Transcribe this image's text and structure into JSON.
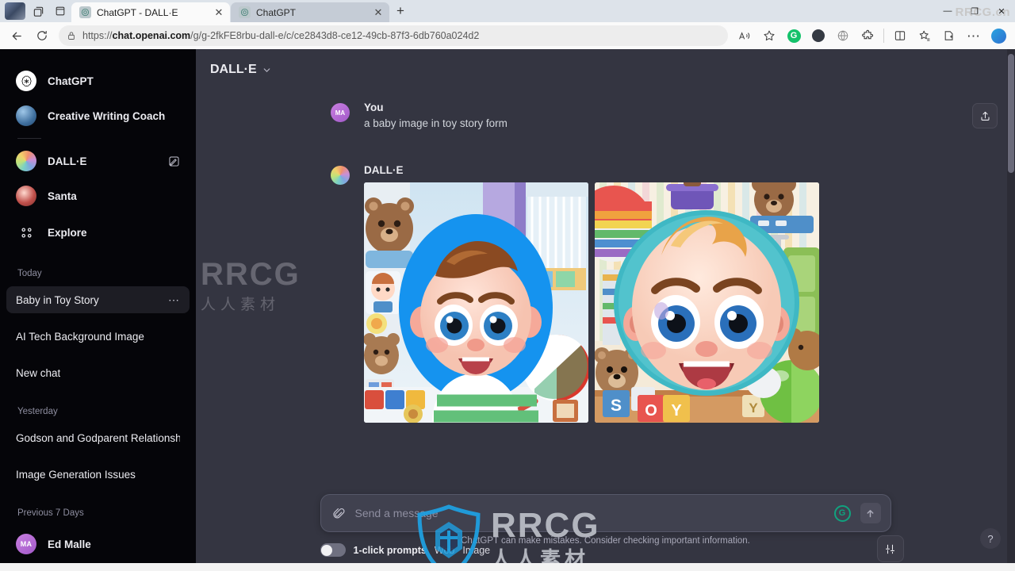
{
  "browser": {
    "tabs": [
      {
        "title": "ChatGPT - DALL·E",
        "active": true,
        "close": "✕"
      },
      {
        "title": "ChatGPT",
        "active": false,
        "close": "✕"
      }
    ],
    "new_tab_label": "+",
    "window_controls": {
      "minimize": "—",
      "maximize": "❐",
      "close": "✕"
    },
    "window_watermark": "RRCG.cn",
    "url_prefix": "https://",
    "url_domain": "chat.openai.com",
    "url_path": "/g/g-2fkFE8rbu-dall-e/c/ce2843d8-ce12-49cb-87f3-6db760a024d2",
    "nav": {
      "back": "back-arrow",
      "reload": "reload-arrow",
      "lock": "lock-icon"
    },
    "toolbar_icons": [
      "read-aloud-icon",
      "favorite-star-icon",
      "grammarly-extension-icon",
      "dark-extension-icon",
      "translate-globe-icon",
      "extensions-puzzle-icon",
      "split-screen-icon",
      "collections-icon",
      "browser-essentials-icon",
      "settings-ellipsis-icon",
      "copilot-icon"
    ]
  },
  "sidebar": {
    "gpts": [
      {
        "name": "ChatGPT",
        "icon": "openai-logo-icon",
        "active": false,
        "edit": false
      },
      {
        "name": "Creative Writing Coach",
        "icon": "coach-avatar-icon",
        "active": false,
        "edit": false
      },
      {
        "name": "DALL·E",
        "icon": "dalle-avatar-icon",
        "active": true,
        "edit": true
      },
      {
        "name": "Santa",
        "icon": "santa-avatar-icon",
        "active": false,
        "edit": false
      }
    ],
    "explore": {
      "label": "Explore",
      "icon": "grid-icon"
    },
    "sections": [
      {
        "label": "Today",
        "items": [
          {
            "title": "Baby in Toy Story",
            "active": true,
            "menu": "⋯"
          },
          {
            "title": "AI Tech Background Image",
            "active": false,
            "menu": ""
          },
          {
            "title": "New chat",
            "active": false,
            "menu": ""
          }
        ]
      },
      {
        "label": "Yesterday",
        "items": [
          {
            "title": "Godson and Godparent Relationship",
            "active": false,
            "menu": ""
          },
          {
            "title": "Image Generation Issues",
            "active": false,
            "menu": ""
          }
        ]
      },
      {
        "label": "Previous 7 Days",
        "items": []
      }
    ],
    "user": {
      "name": "Ed Malle",
      "initials": "MA"
    }
  },
  "main": {
    "model_name": "DALL·E",
    "model_chevron": "chevron-down-icon",
    "share_icon": "share-upload-icon",
    "messages": [
      {
        "author": "You",
        "initials": "MA",
        "text": "a baby image in toy story form",
        "type": "user"
      },
      {
        "author": "DALL·E",
        "initials": "",
        "text": "",
        "type": "assistant",
        "images": [
          {
            "alt": "Cartoon baby with blue oval background in a toy-filled nursery"
          },
          {
            "alt": "Close-up cartoon baby face with teal circle background and alphabet blocks"
          }
        ]
      }
    ],
    "composer": {
      "attach_icon": "paperclip-icon",
      "placeholder": "Send a message",
      "assist_icon": "grammarly-circle-icon",
      "send_icon": "send-arrow-up-icon"
    },
    "bottom_bar": {
      "toggle_label": "1-click prompts",
      "toggle_on": false,
      "options": [
        "Web",
        "Image"
      ],
      "settings_icon": "sliders-icon"
    },
    "disclaimer": "ChatGPT can make mistakes. Consider checking important information.",
    "help_label": "?"
  },
  "watermarks": {
    "brand": "RRCG",
    "brand_cn": "人人素材",
    "corner": "RRCG.cn"
  },
  "colors": {
    "sidebar_bg": "#050509",
    "main_bg": "#343541",
    "accent_green": "#10a37f",
    "composer_bg": "#40414f",
    "text_primary": "#ececf1",
    "text_muted": "#8e8ea0"
  }
}
